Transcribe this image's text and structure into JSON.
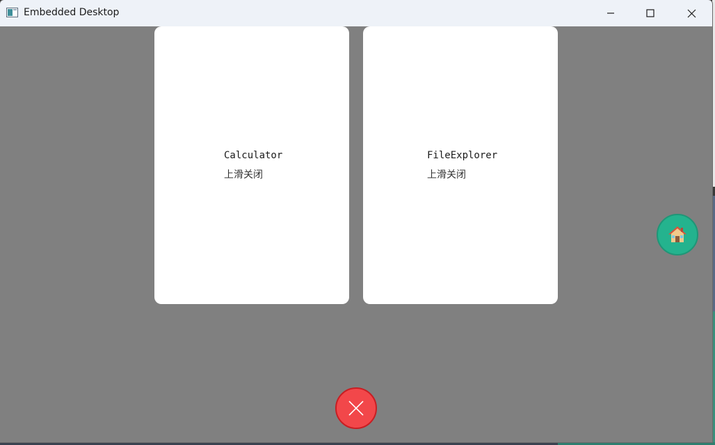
{
  "window": {
    "title": "Embedded Desktop",
    "controls": {
      "minimize_icon": "minimize-icon",
      "maximize_icon": "maximize-icon",
      "close_icon": "close-icon"
    }
  },
  "task_switcher": {
    "cards": [
      {
        "app_name": "Calculator",
        "hint": "上滑关闭"
      },
      {
        "app_name": "FileExplorer",
        "hint": "上滑关闭"
      }
    ],
    "background_color": "#808080"
  },
  "home_button": {
    "icon": "house-icon",
    "color": "#24b38e"
  },
  "close_all_button": {
    "icon": "x-icon",
    "color": "#f2474a"
  }
}
